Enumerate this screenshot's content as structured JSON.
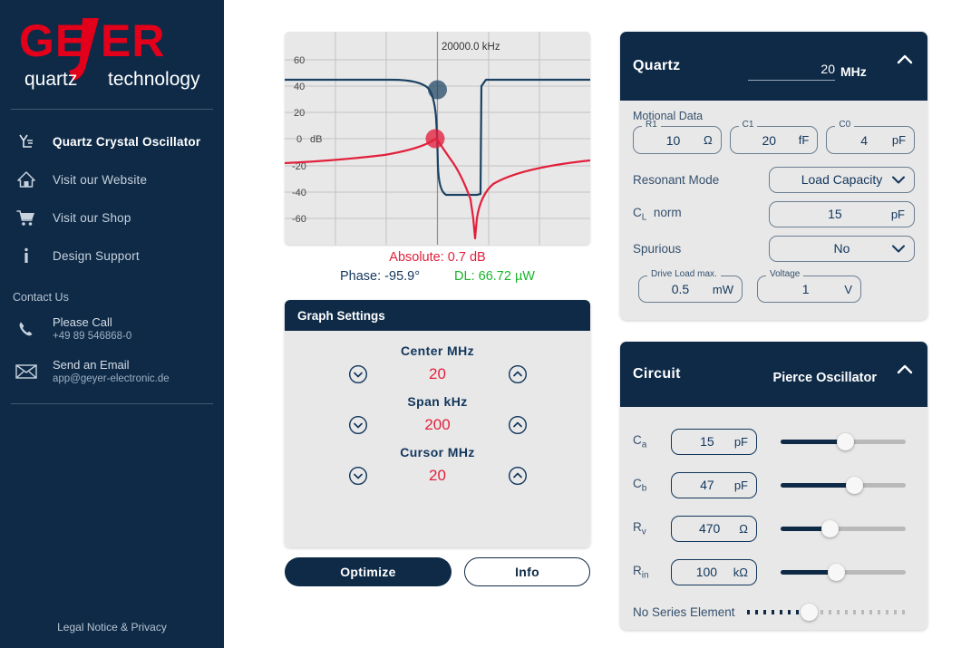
{
  "sidebar": {
    "logo": {
      "brand": "GEYER",
      "tagline_left": "quartz",
      "tagline_right": "technology"
    },
    "nav": [
      {
        "label": "Quartz Crystal Oscillator",
        "icon": "oscillator-icon",
        "active": true
      },
      {
        "label": "Visit our Website",
        "icon": "home-icon",
        "active": false
      },
      {
        "label": "Visit our Shop",
        "icon": "cart-icon",
        "active": false
      },
      {
        "label": "Design Support",
        "icon": "info-icon",
        "active": false
      }
    ],
    "contact_title": "Contact Us",
    "contacts": [
      {
        "icon": "phone-icon",
        "main": "Please Call",
        "sub": "+49 89 546868-0"
      },
      {
        "icon": "mail-icon",
        "main": "Send an Email",
        "sub": "app@geyer-electronic.de"
      }
    ],
    "legal": "Legal Notice & Privacy"
  },
  "chart": {
    "cursor_label": "20000.0 kHz",
    "y_ticks": [
      "60",
      "40",
      "20",
      "0",
      "-20",
      "-40",
      "-60"
    ],
    "y_unit": "dB",
    "readouts": {
      "absolute": "Absolute: 0.7 dB",
      "phase": "Phase: -95.9°",
      "drive_level": "DL: 66.72 µW"
    }
  },
  "chart_data": {
    "type": "line",
    "title": "",
    "xlabel": "",
    "ylabel": "dB",
    "ylim": [
      -70,
      70
    ],
    "yticks": [
      60,
      40,
      20,
      0,
      -20,
      -40,
      -60
    ],
    "grid": true,
    "legend": null,
    "cursor_x_label": "20000.0 kHz",
    "series": [
      {
        "name": "Phase",
        "color": "#1b4263",
        "cursor_value": -95.9,
        "cursor_unit": "deg"
      },
      {
        "name": "Absolute",
        "color": "#e2203c",
        "cursor_value": 0.7,
        "cursor_unit": "dB"
      }
    ],
    "annotations": [
      "Absolute: 0.7 dB",
      "Phase: -95.9°",
      "DL: 66.72 µW"
    ]
  },
  "graph_settings": {
    "title": "Graph Settings",
    "groups": [
      {
        "label": "Center  MHz",
        "value": "20",
        "down_icon": "chevron-down-circle-icon",
        "up_icon": "chevron-up-circle-icon"
      },
      {
        "label": "Span  kHz",
        "value": "200",
        "down_icon": "chevron-down-circle-icon",
        "up_icon": "chevron-up-circle-icon"
      },
      {
        "label": "Cursor  MHz",
        "value": "20",
        "down_icon": "chevron-down-circle-icon",
        "up_icon": "chevron-up-circle-icon"
      }
    ]
  },
  "buttons": {
    "optimize": "Optimize",
    "info": "Info"
  },
  "quartz": {
    "title": "Quartz",
    "frequency_value": "20",
    "frequency_unit": "MHz",
    "collapse_icon": "chevron-up-icon",
    "motional_label": "Motional Data",
    "motional": [
      {
        "legend": "R1",
        "value": "10",
        "unit": "Ω"
      },
      {
        "legend": "C1",
        "value": "20",
        "unit": "fF"
      },
      {
        "legend": "C0",
        "value": "4",
        "unit": "pF"
      }
    ],
    "resonant_mode_label": "Resonant Mode",
    "resonant_mode_value": "Load Capacity",
    "cl_label": "norm",
    "cl_value": "15",
    "cl_unit": "pF",
    "spurious_label": "Spurious",
    "spurious_value": "No",
    "drive_load": {
      "legend": "Drive Load max.",
      "value": "0.5",
      "unit": "mW"
    },
    "voltage": {
      "legend": "Voltage",
      "value": "1",
      "unit": "V"
    }
  },
  "circuit": {
    "title": "Circuit",
    "subtitle": "Pierce Oscillator",
    "collapse_icon": "chevron-up-icon",
    "rows": [
      {
        "label": "Ca",
        "value": "15",
        "unit": "pF",
        "slider_pct": 58
      },
      {
        "label": "Cb",
        "value": "47",
        "unit": "pF",
        "slider_pct": 68
      },
      {
        "label": "Rv",
        "value": "470",
        "unit": "Ω",
        "slider_pct": 45
      },
      {
        "label": "Rin",
        "value": "100",
        "unit": "kΩ",
        "slider_pct": 50
      }
    ],
    "series_element_label": "No Series Element",
    "series_element_pct": 47
  },
  "colors": {
    "navy": "#0e2a47",
    "red": "#e2203c",
    "green": "#18b52a",
    "panel_bg": "#e8e8e8"
  }
}
